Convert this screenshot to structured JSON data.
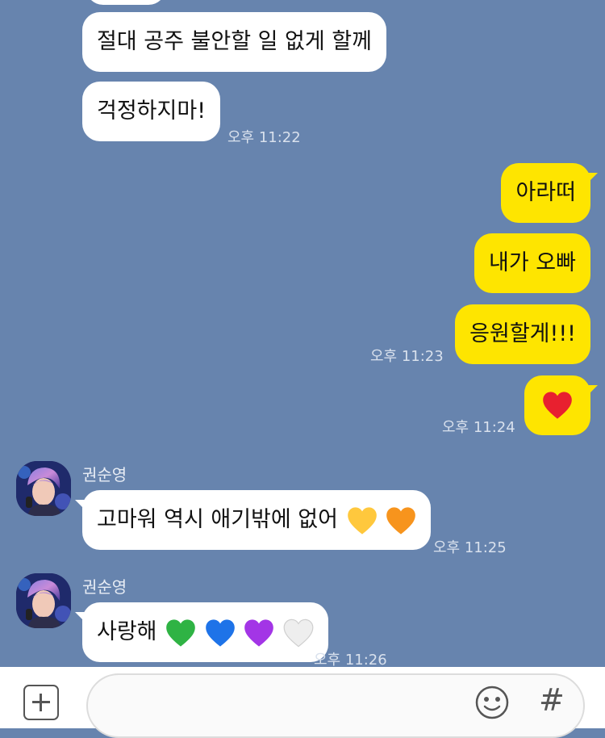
{
  "messages": {
    "m1": "절대 공주 불안할 일 없게 할께",
    "m2": "걱정하지마!",
    "t1": "오후 11:22",
    "m3": "아라떠",
    "m4": "내가 오빠",
    "m5": "응원할게!!!",
    "t2": "오후 11:23",
    "m6_icon": "red-heart-icon",
    "t3": "오후 11:24",
    "sender1": "권순영",
    "m7": "고마워 역시 애기밖에 없어",
    "m7_icons": [
      "yellow-heart-icon",
      "orange-heart-icon"
    ],
    "t4": "오후 11:25",
    "sender2": "권순영",
    "m8": "사랑해",
    "m8_icons": [
      "green-heart-icon",
      "blue-heart-icon",
      "purple-heart-icon",
      "white-heart-icon"
    ],
    "t5": "오후 11:26"
  },
  "input": {
    "placeholder": "",
    "plus_icon": "plus-icon",
    "emoji_icon": "emoji-icon",
    "hash_label": "#"
  },
  "colors": {
    "background": "#6784ae",
    "outgoing_bubble": "#fee500",
    "incoming_bubble": "#ffffff",
    "red": "#e8202f",
    "yellow": "#ffc83d",
    "orange": "#f7941d",
    "green": "#2fb344",
    "blue": "#1e73e8",
    "purple": "#a335e6",
    "white": "#f2f2f2"
  }
}
